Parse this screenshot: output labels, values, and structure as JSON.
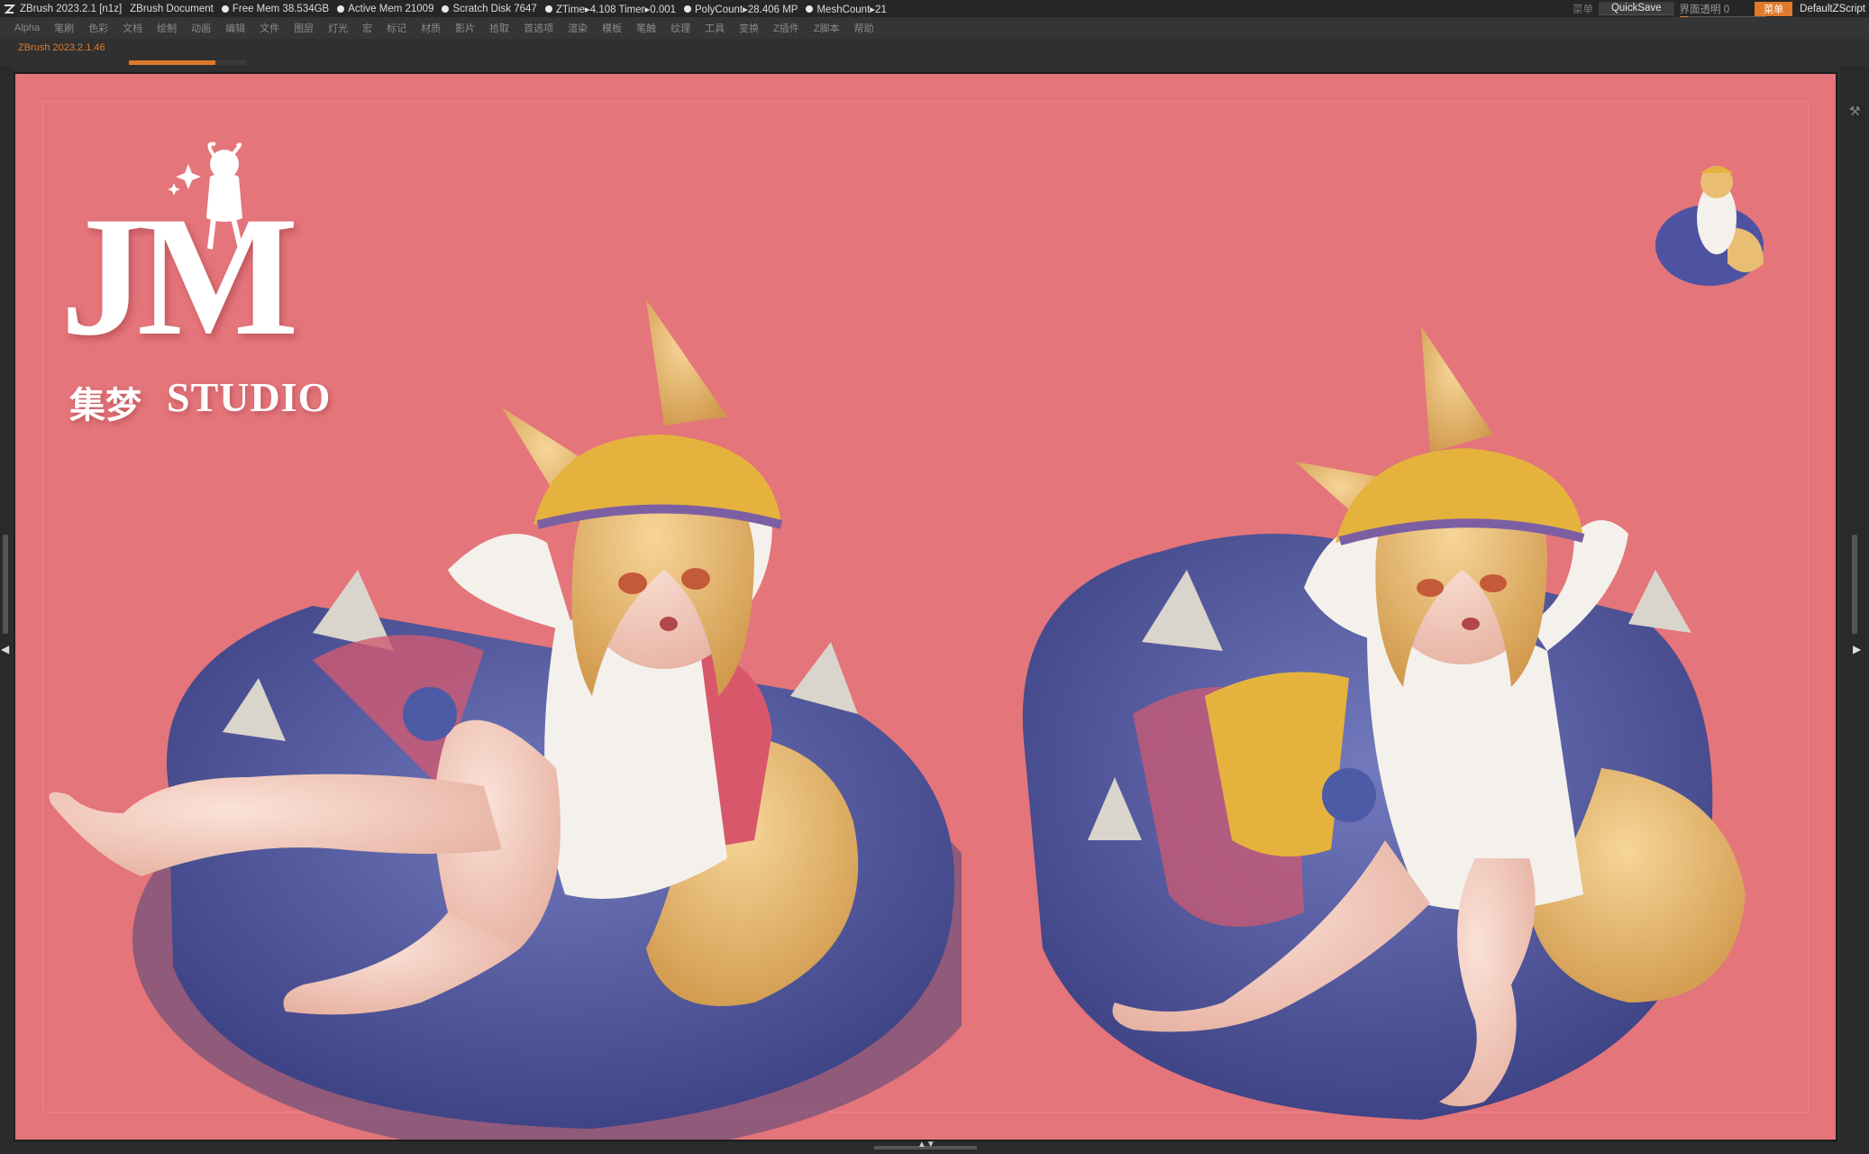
{
  "titlebar": {
    "app_title": "ZBrush 2023.2.1 [n1z]",
    "document": "ZBrush Document",
    "stats": [
      {
        "label": "Free Mem 38.534GB"
      },
      {
        "label": "Active Mem 21009"
      },
      {
        "label": "Scratch Disk 7647"
      },
      {
        "label": "ZTime▸4.108 Timer▸0.001"
      },
      {
        "label": "PolyCount▸28.406 MP"
      },
      {
        "label": "MeshCount▸21"
      }
    ],
    "gray_label": "菜单",
    "quicksave": "QuickSave",
    "transparency_label": "界面透明 0",
    "transparency_value": 0.1,
    "menu_button": "菜单",
    "script_name": "DefaultZScript"
  },
  "menubar": {
    "items": [
      "Alpha",
      "笔刷",
      "色彩",
      "文档",
      "绘制",
      "动画",
      "编辑",
      "文件",
      "图层",
      "灯光",
      "宏",
      "标记",
      "材质",
      "影片",
      "拾取",
      "首选项",
      "渲染",
      "模板",
      "笔触",
      "纹理",
      "工具",
      "变换",
      "Z插件",
      "Z脚本",
      "帮助"
    ]
  },
  "docbar": {
    "version": "ZBrush 2023.2.1.46",
    "progress": 0.74
  },
  "logo": {
    "jm": "JM",
    "chinese": "集梦",
    "studio": "STUDIO"
  },
  "colors": {
    "canvas_bg": "#e4757a",
    "accent": "#e07a2a",
    "pillow_blue": "#5b63a8",
    "hat_yellow": "#e5b33d",
    "hair_blonde": "#e9bd72",
    "shirt_white": "#f4f1ec",
    "skin": "#f3cfc0"
  }
}
